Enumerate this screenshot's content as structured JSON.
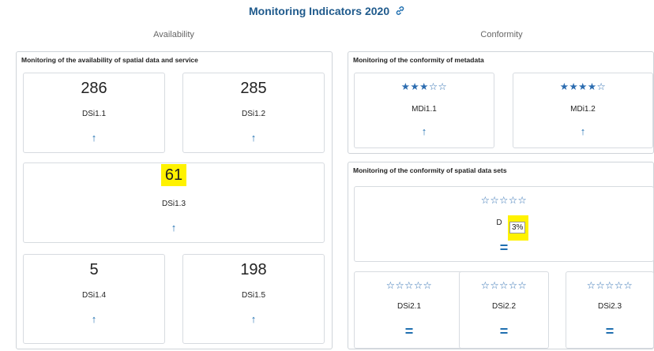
{
  "header": {
    "title": "Monitoring Indicators 2020"
  },
  "columns": {
    "availability": "Availability",
    "conformity": "Conformity"
  },
  "availability_panel": {
    "title": "Monitoring of the availability of spatial data and service",
    "cards": [
      {
        "value": "286",
        "label": "DSi1.1",
        "trend": "↑"
      },
      {
        "value": "285",
        "label": "DSi1.2",
        "trend": "↑"
      },
      {
        "value": "61",
        "label": "DSi1.3",
        "trend": "↑"
      },
      {
        "value": "5",
        "label": "DSi1.4",
        "trend": "↑"
      },
      {
        "value": "198",
        "label": "DSi1.5",
        "trend": "↑"
      }
    ]
  },
  "metadata_panel": {
    "title": "Monitoring of the conformity of metadata",
    "cards": [
      {
        "stars": "★★★☆☆",
        "label": "MDi1.1",
        "trend": "↑",
        "rating": 3
      },
      {
        "stars": "★★★★☆",
        "label": "MDi1.2",
        "trend": "↑",
        "rating": 4
      }
    ]
  },
  "datasets_panel": {
    "title": "Monitoring of the conformity of spatial data sets",
    "main_card": {
      "stars": "☆☆☆☆☆",
      "label_partial": "D",
      "tooltip": "3%",
      "trend": "="
    },
    "cards": [
      {
        "stars": "☆☆☆☆☆",
        "label": "DSi2.1",
        "trend": "="
      },
      {
        "stars": "☆☆☆☆☆",
        "label": "DSi2.2",
        "trend": "="
      },
      {
        "stars": "☆☆☆☆☆",
        "label": "DSi2.3",
        "trend": "="
      }
    ]
  },
  "colors": {
    "accent": "#1f6fb0",
    "title": "#1f5a8c",
    "highlight": "#fff200",
    "border": "#d7dbe0"
  }
}
